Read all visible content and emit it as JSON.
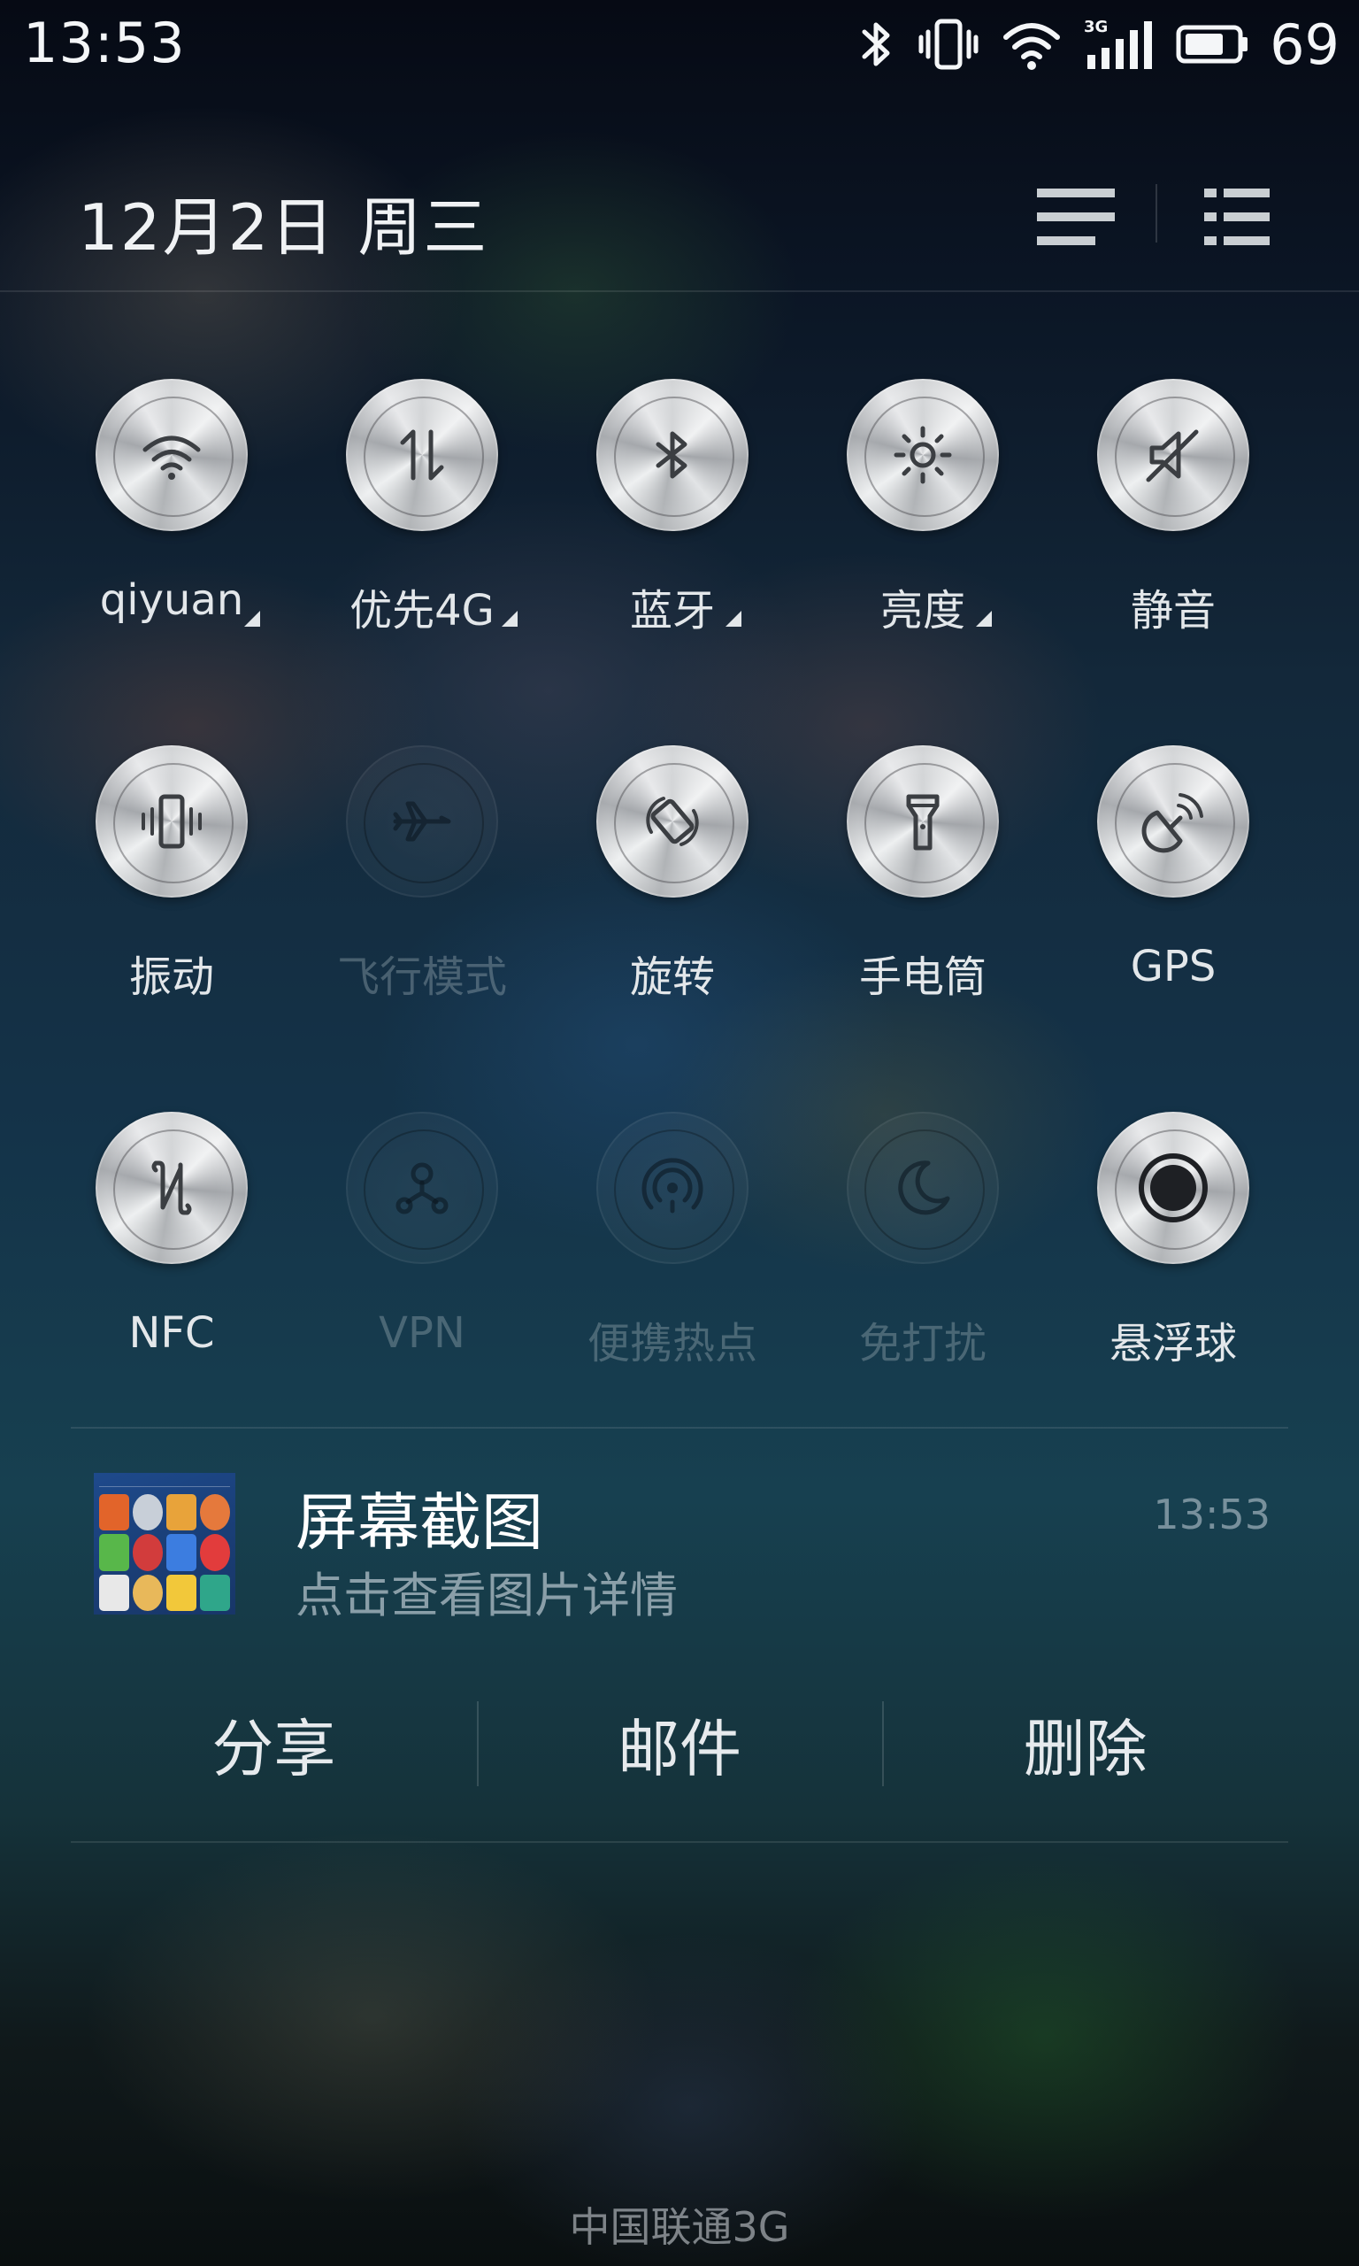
{
  "status_bar": {
    "time": "13:53",
    "battery_level": "69",
    "icons": [
      "bluetooth-icon",
      "vibrate-icon",
      "wifi-icon",
      "signal-3g-icon",
      "battery-icon"
    ],
    "network_type_badge": "3G"
  },
  "header": {
    "date": "12月2日  周三",
    "buttons": [
      "notification-list-icon",
      "settings-list-icon"
    ]
  },
  "toggles": [
    {
      "id": "wifi",
      "label": "qiyuan",
      "icon": "wifi-icon",
      "active": true,
      "has_more": true
    },
    {
      "id": "data",
      "label": "优先4G",
      "icon": "mobile-data-icon",
      "active": true,
      "has_more": true
    },
    {
      "id": "bluetooth",
      "label": "蓝牙",
      "icon": "bluetooth-icon",
      "active": true,
      "has_more": true
    },
    {
      "id": "brightness",
      "label": "亮度",
      "icon": "brightness-icon",
      "active": true,
      "has_more": true
    },
    {
      "id": "mute",
      "label": "静音",
      "icon": "mute-icon",
      "active": true,
      "has_more": false
    },
    {
      "id": "vibrate",
      "label": "振动",
      "icon": "vibrate-icon",
      "active": true,
      "has_more": false
    },
    {
      "id": "airplane",
      "label": "飞行模式",
      "icon": "airplane-icon",
      "active": false,
      "has_more": false
    },
    {
      "id": "rotate",
      "label": "旋转",
      "icon": "rotate-icon",
      "active": true,
      "has_more": false
    },
    {
      "id": "flashlight",
      "label": "手电筒",
      "icon": "flashlight-icon",
      "active": true,
      "has_more": false
    },
    {
      "id": "gps",
      "label": "GPS",
      "icon": "gps-icon",
      "active": true,
      "has_more": false
    },
    {
      "id": "nfc",
      "label": "NFC",
      "icon": "nfc-icon",
      "active": true,
      "has_more": false
    },
    {
      "id": "vpn",
      "label": "VPN",
      "icon": "vpn-icon",
      "active": false,
      "has_more": false
    },
    {
      "id": "hotspot",
      "label": "便携热点",
      "icon": "hotspot-icon",
      "active": false,
      "has_more": false
    },
    {
      "id": "dnd",
      "label": "免打扰",
      "icon": "moon-icon",
      "active": false,
      "has_more": false
    },
    {
      "id": "floatball",
      "label": "悬浮球",
      "icon": "floating-ball-icon",
      "active": true,
      "has_more": false
    }
  ],
  "notification": {
    "title": "屏幕截图",
    "subtitle": "点击查看图片详情",
    "time": "13:53",
    "thumbnail": "screenshot-thumbnail",
    "actions": [
      "分享",
      "邮件",
      "删除"
    ]
  },
  "carrier": "中国联通3G",
  "colors": {
    "toggle_on": "#d8dadc",
    "toggle_off": "#3a4a56",
    "text_primary": "#e8ecef",
    "text_dim": "#8fa0ab"
  }
}
